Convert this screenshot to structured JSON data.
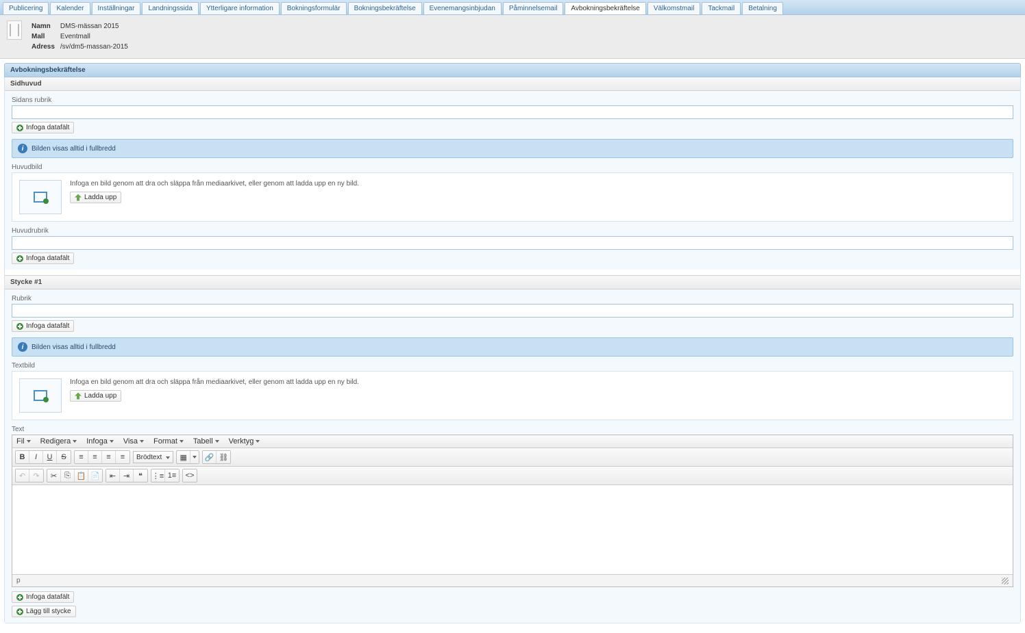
{
  "tabs": [
    {
      "label": "Publicering"
    },
    {
      "label": "Kalender"
    },
    {
      "label": "Inställningar"
    },
    {
      "label": "Landningssida"
    },
    {
      "label": "Ytterligare information"
    },
    {
      "label": "Bokningsformulär"
    },
    {
      "label": "Bokningsbekräftelse"
    },
    {
      "label": "Evenemangsinbjudan"
    },
    {
      "label": "Påminnelsemail"
    },
    {
      "label": "Avbokningsbekräftelse"
    },
    {
      "label": "Välkomstmail"
    },
    {
      "label": "Tackmail"
    },
    {
      "label": "Betalning"
    }
  ],
  "active_tab_index": 9,
  "info": {
    "name_label": "Namn",
    "name_value": "DMS-mässan 2015",
    "mall_label": "Mall",
    "mall_value": "Eventmall",
    "adress_label": "Adress",
    "adress_value": "/sv/dm5-massan-2015"
  },
  "section_title": "Avbokningsbekräftelse",
  "sidhuvud": {
    "header": "Sidhuvud",
    "rubrik_label": "Sidans rubrik",
    "rubrik_value": "",
    "infoga_datafalt": "Infoga datafält",
    "info_text": "Bilden visas alltid i fullbredd",
    "huvudbild_label": "Huvudbild",
    "image_help": "Infoga en bild genom att dra och släppa från mediaarkivet, eller genom att ladda upp en ny bild.",
    "ladda_upp": "Ladda upp",
    "huvudrubrik_label": "Huvudrubrik",
    "huvudrubrik_value": ""
  },
  "stycke": {
    "header": "Stycke #1",
    "rubrik_label": "Rubrik",
    "rubrik_value": "",
    "infoga_datafalt": "Infoga datafält",
    "info_text": "Bilden visas alltid i fullbredd",
    "textbild_label": "Textbild",
    "image_help": "Infoga en bild genom att dra och släppa från mediaarkivet, eller genom att ladda upp en ny bild.",
    "ladda_upp": "Ladda upp",
    "text_label": "Text"
  },
  "editor": {
    "menu": {
      "fil": "Fil",
      "redigera": "Redigera",
      "infoga": "Infoga",
      "visa": "Visa",
      "format": "Format",
      "tabell": "Tabell",
      "verktyg": "Verktyg"
    },
    "format_select": "Brödtext",
    "status": "p"
  },
  "bottom": {
    "infoga_datafalt": "Infoga datafält",
    "lagg_till": "Lägg till stycke"
  }
}
